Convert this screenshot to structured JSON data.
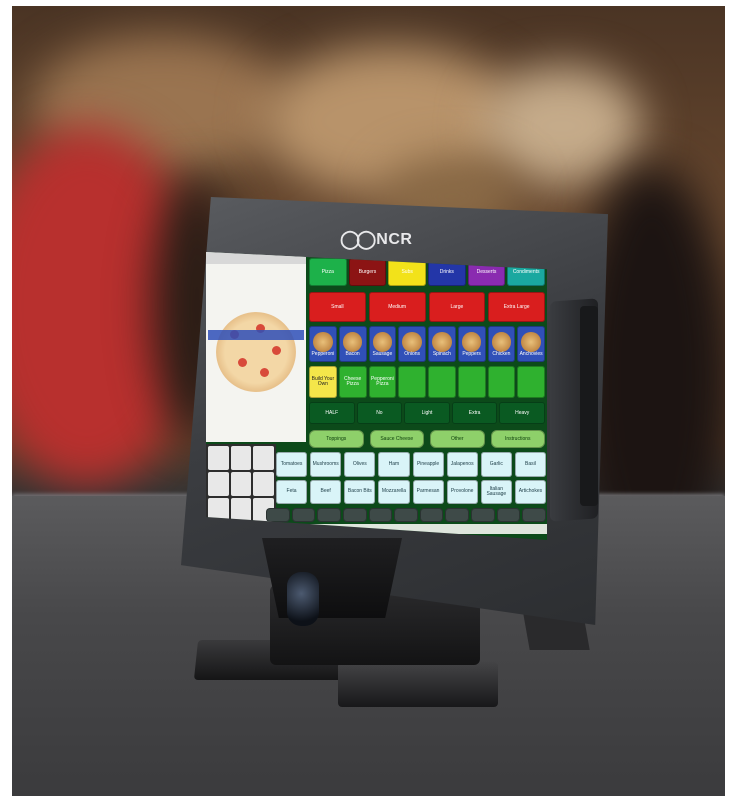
{
  "monitor": {
    "brand": "NCR"
  },
  "pos_screen": {
    "categories": [
      {
        "label": "Pizza",
        "color": "#1db14a"
      },
      {
        "label": "Burgers",
        "color": "#8c1414"
      },
      {
        "label": "Subs",
        "color": "#f2e21a"
      },
      {
        "label": "Drinks",
        "color": "#2336a8"
      },
      {
        "label": "Desserts",
        "color": "#8a2bb0"
      },
      {
        "label": "Condiments",
        "color": "#1aa8a0"
      }
    ],
    "sizes": [
      "Small",
      "Medium",
      "Large",
      "Extra Large"
    ],
    "toppings": [
      "Pepperoni",
      "Bacon",
      "Sausage",
      "Onions",
      "Spinach",
      "Peppers",
      "Chicken",
      "Anchovies"
    ],
    "green_buttons": [
      "Build Your Own",
      "Cheese Pizza",
      "Pepperoni Pizza",
      "",
      "",
      "",
      "",
      ""
    ],
    "portions": [
      "HALF",
      "No",
      "Light",
      "Extra",
      "Heavy"
    ],
    "modifier_tabs": [
      "Toppings",
      "Sauce Cheese",
      "Other",
      "Instructions"
    ],
    "modifier_keys": [
      "Tomatoes",
      "Mushrooms",
      "Olives",
      "Ham",
      "Pineapple",
      "Jalapenos",
      "Garlic",
      "Basil",
      "Feta",
      "Beef",
      "Bacon Bits",
      "Mozzarella",
      "Parmesan",
      "Provolone",
      "Italian Sausage",
      "Artichokes"
    ],
    "function_keys": [
      "",
      "",
      "",
      "",
      "",
      "",
      "",
      "",
      "",
      "",
      ""
    ],
    "status_left": "",
    "status_right": ""
  }
}
